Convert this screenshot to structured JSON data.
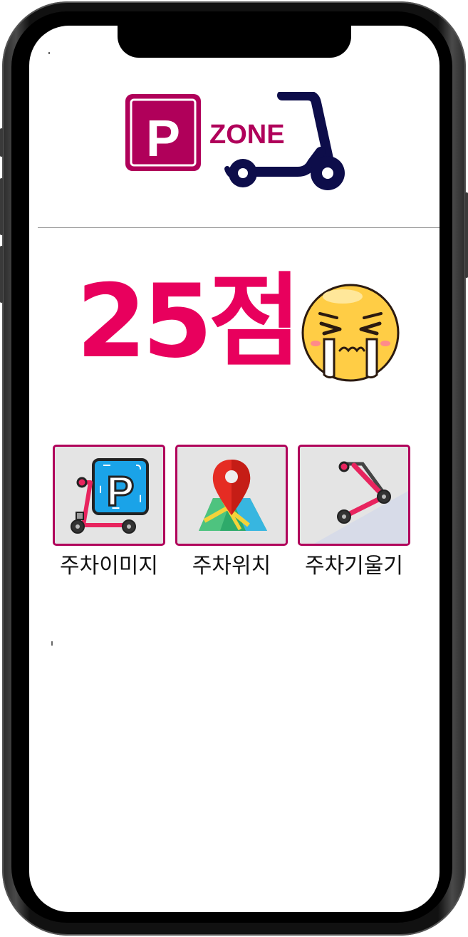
{
  "logo": {
    "letter": "P",
    "word": "ZONE",
    "brand_color": "#b0005a",
    "scooter_color": "#0d0d4a"
  },
  "score": {
    "text": "25점",
    "color": "#e8005d",
    "emoji_icon": "crying-face-icon"
  },
  "menu": {
    "items": [
      {
        "label": "주차이미지",
        "icon": "scooter-parking-icon"
      },
      {
        "label": "주차위치",
        "icon": "map-pin-icon"
      },
      {
        "label": "주차기울기",
        "icon": "scooter-tilt-icon"
      }
    ],
    "border_color": "#b0005a"
  }
}
